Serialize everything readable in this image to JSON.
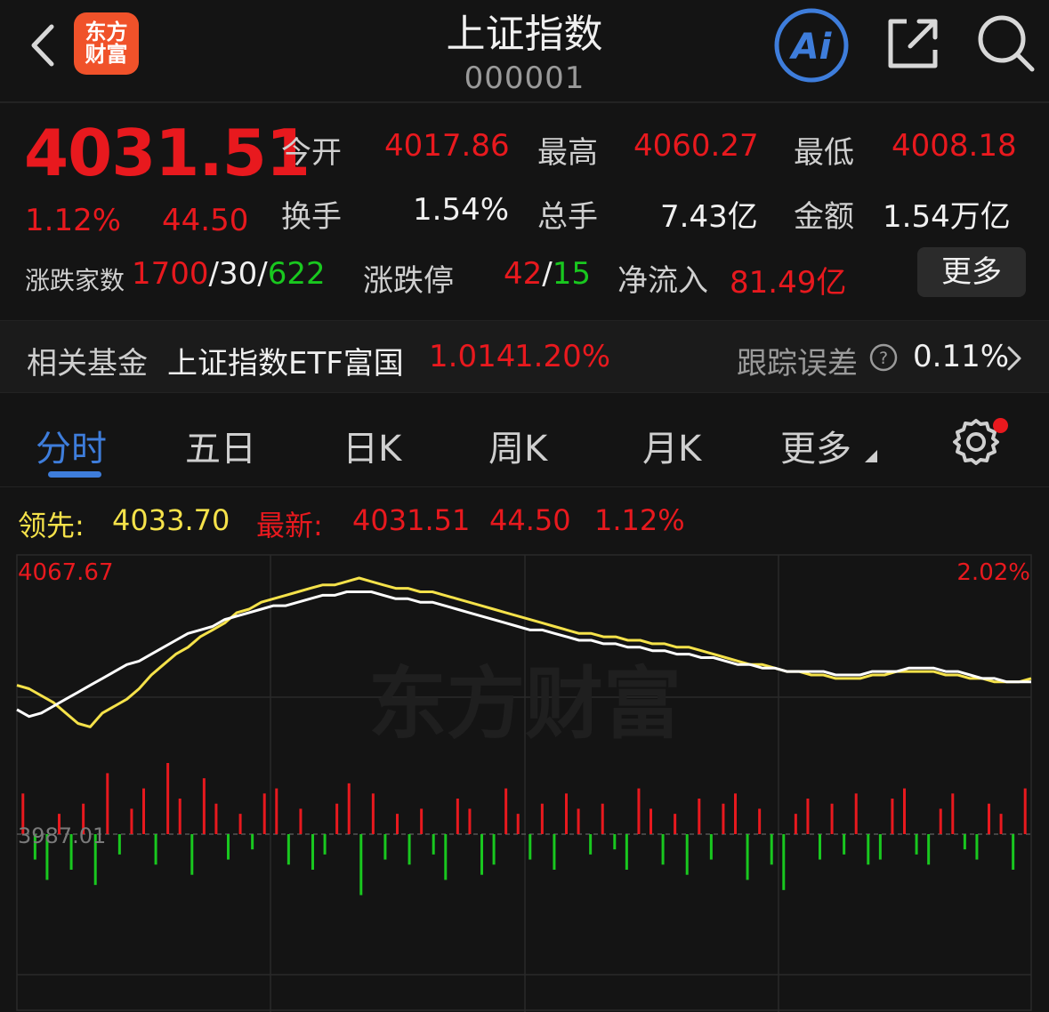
{
  "header": {
    "logo_line1": "东方",
    "logo_line2": "财富",
    "title": "上证指数",
    "code": "000001",
    "ai_label": "Ai"
  },
  "quote": {
    "price": "4031.51",
    "change_pct": "1.12%",
    "change_amt": "44.50",
    "open_label": "今开",
    "open_value": "4017.86",
    "high_label": "最高",
    "high_value": "4060.27",
    "low_label": "最低",
    "low_value": "4008.18",
    "turnover_label": "换手",
    "turnover_value": "1.54%",
    "volume_label": "总手",
    "volume_value": "7.43亿",
    "amount_label": "金额",
    "amount_value": "1.54万亿",
    "breadth_label": "涨跌家数",
    "breadth_up": "1700",
    "sep1": "/",
    "breadth_flat": "30",
    "sep2": "/",
    "breadth_down": "622",
    "limit_label": "涨跌停",
    "limit_up": "42",
    "sep3": "/",
    "limit_down": "15",
    "netflow_label": "净流入",
    "netflow_value": "81.49亿",
    "more_label": "更多"
  },
  "fund": {
    "label": "相关基金",
    "name": "上证指数ETF富国",
    "price": "1.014",
    "pct": "1.20%",
    "tracking_label": "跟踪误差",
    "tracking_value": "0.11%"
  },
  "tabs": [
    {
      "label": "分时"
    },
    {
      "label": "五日"
    },
    {
      "label": "日K"
    },
    {
      "label": "周K"
    },
    {
      "label": "月K"
    },
    {
      "label": "更多"
    }
  ],
  "info": {
    "lead_label": "领先:",
    "lead_value": "4033.70",
    "last_label": "最新:",
    "last_value": "4031.51",
    "last_change": "44.50",
    "last_pct": "1.12%"
  },
  "colors": {
    "up": "#e8191e",
    "down": "#19c81f",
    "accent": "#3e7ddb",
    "lead_line": "#f5e24a",
    "price_line": "#ffffff"
  },
  "chart_data": {
    "type": "line",
    "y_max_label": "4067.67",
    "y_max_pct_label": "2.02%",
    "baseline_label": "3987.01",
    "ylim": [
      3987.01,
      4067.67
    ],
    "watermark": "东方财富",
    "series": [
      {
        "name": "领先",
        "values": [
          4030,
          4029,
          4027,
          4025,
          4022,
          4019,
          4018,
          4022,
          4024,
          4026,
          4029,
          4033,
          4036,
          4039,
          4041,
          4044,
          4046,
          4048,
          4051,
          4052,
          4054,
          4055,
          4056,
          4057,
          4058,
          4059,
          4059,
          4060,
          4061,
          4060,
          4059,
          4058,
          4058,
          4057,
          4057,
          4056,
          4055,
          4054,
          4053,
          4052,
          4051,
          4050,
          4049,
          4048,
          4047,
          4046,
          4045,
          4045,
          4044,
          4044,
          4043,
          4043,
          4042,
          4042,
          4041,
          4041,
          4040,
          4039,
          4038,
          4037,
          4036,
          4036,
          4035,
          4034,
          4034,
          4033,
          4033,
          4032,
          4032,
          4032,
          4033,
          4033,
          4034,
          4034,
          4034,
          4034,
          4033,
          4033,
          4032,
          4032,
          4031,
          4031,
          4031,
          4032
        ],
        "color": "#f5e24a"
      },
      {
        "name": "最新",
        "values": [
          4023,
          4021,
          4022,
          4024,
          4026,
          4028,
          4030,
          4032,
          4034,
          4036,
          4037,
          4039,
          4041,
          4043,
          4045,
          4046,
          4047,
          4049,
          4050,
          4051,
          4052,
          4053,
          4053,
          4054,
          4055,
          4056,
          4056,
          4057,
          4057,
          4057,
          4056,
          4055,
          4055,
          4054,
          4054,
          4053,
          4052,
          4051,
          4050,
          4049,
          4048,
          4047,
          4046,
          4046,
          4045,
          4044,
          4043,
          4043,
          4042,
          4042,
          4041,
          4041,
          4040,
          4040,
          4039,
          4039,
          4038,
          4038,
          4037,
          4036,
          4036,
          4035,
          4035,
          4034,
          4034,
          4034,
          4034,
          4033,
          4033,
          4033,
          4034,
          4034,
          4034,
          4035,
          4035,
          4035,
          4034,
          4034,
          4033,
          4032,
          4032,
          4031,
          4031,
          4031
        ],
        "color": "#ffffff"
      }
    ],
    "volume_bars": [
      8,
      -5,
      -9,
      4,
      -7,
      6,
      -10,
      12,
      -4,
      5,
      9,
      -6,
      14,
      7,
      -8,
      11,
      6,
      -5,
      4,
      -3,
      8,
      9,
      -6,
      5,
      -7,
      -4,
      6,
      10,
      -12,
      8,
      -5,
      4,
      -6,
      5,
      -4,
      -9,
      7,
      5,
      -8,
      -6,
      9,
      4,
      -5,
      6,
      -7,
      8,
      5,
      -4,
      6,
      -3,
      -7,
      9,
      5,
      -6,
      4,
      -8,
      7,
      -5,
      6,
      8,
      -9,
      5,
      -6,
      -11,
      4,
      7,
      -5,
      6,
      -4,
      8,
      -6,
      -5,
      7,
      9,
      -4,
      -6,
      5,
      8,
      -3,
      -5,
      6,
      4,
      -7,
      9
    ],
    "volume_ylim": [
      -14,
      14
    ]
  }
}
